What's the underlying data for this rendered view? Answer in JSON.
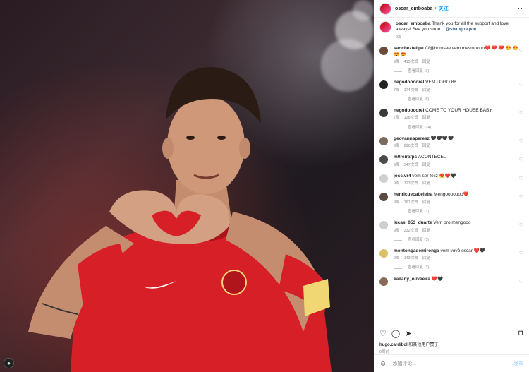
{
  "header": {
    "username": "oscar_emboaba",
    "separator": "•",
    "follow_label": "关注",
    "more": "···"
  },
  "caption": {
    "username": "oscar_emboaba",
    "text": " Thank you for all the support and love always! See you soon... ",
    "mention": "@shanghaiport",
    "time": "9周"
  },
  "comments": [
    {
      "user": "sanchezfelipe",
      "text": " Cℓ@homsee vem mesmoooo❤️ ❤️ ❤️ 😍 😍 😍 😍",
      "time": "9周",
      "likes": "415次赞",
      "reply": "回复",
      "view_replies": "查看回复 (3)"
    },
    {
      "user": "negodoooorel",
      "text": " VEM LOGO 88",
      "time": "7周",
      "likes": "174次赞",
      "reply": "回复",
      "view_replies": "查看回复 (6)"
    },
    {
      "user": "negodoooorel",
      "text": " COME TO YOUR HOUSE BABY",
      "time": "7周",
      "likes": "128次赞",
      "reply": "回复",
      "view_replies": "查看回复 (14)"
    },
    {
      "user": "geovannaperesz",
      "text": " 🖤🖤🖤🖤",
      "time": "9周",
      "likes": "896次赞",
      "reply": "回复",
      "view_replies": ""
    },
    {
      "user": "m0reirafps",
      "text": " ACONTECEU",
      "time": "9周",
      "likes": "347次赞",
      "reply": "回复",
      "view_replies": ""
    },
    {
      "user": "josc.vr4",
      "text": " vem ser feliz 😍❤️🖤",
      "time": "9周",
      "likes": "123次赞",
      "reply": "回复",
      "view_replies": ""
    },
    {
      "user": "henricuecabeleira",
      "text": " Mengooooooo❤️",
      "time": "9周",
      "likes": "161次赞",
      "reply": "回复",
      "view_replies": "查看回复 (3)"
    },
    {
      "user": "lucas_053_duarte",
      "text": " Vem pro mengooo",
      "time": "9周",
      "likes": "232次赞",
      "reply": "回复",
      "view_replies": "查看回复 (3)"
    },
    {
      "user": "montongademironga",
      "text": " vem vovô oscar ❤️🖤",
      "time": "9周",
      "likes": "143次赞",
      "reply": "回复",
      "view_replies": "查看回复 (3)"
    },
    {
      "user": "kailany_oliveeira",
      "text": " ❤️🖤",
      "time": "",
      "likes": "",
      "reply": "",
      "view_replies": ""
    }
  ],
  "actions": {
    "like": "♡",
    "comment": "◯",
    "share": "➤",
    "save": "⊓"
  },
  "likes_line": {
    "user": "hugo.cardiboli",
    "text": "和其他用户赞了"
  },
  "post_time": "9周前",
  "add_comment": {
    "emoji": "☺",
    "placeholder": "添加评论...",
    "post": "发布"
  }
}
